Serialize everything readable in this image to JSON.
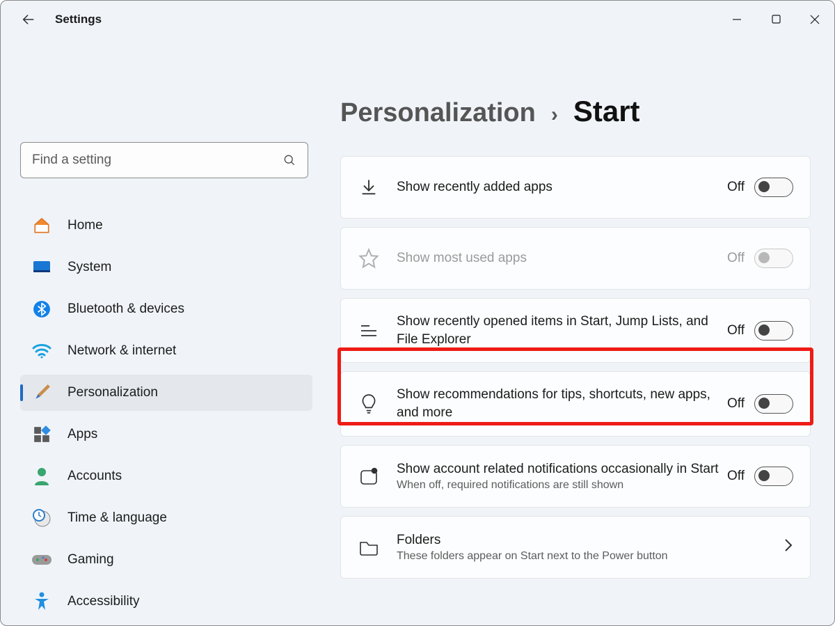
{
  "app_title": "Settings",
  "search_placeholder": "Find a setting",
  "nav": [
    {
      "id": "home",
      "label": "Home"
    },
    {
      "id": "system",
      "label": "System"
    },
    {
      "id": "bluetooth",
      "label": "Bluetooth & devices"
    },
    {
      "id": "network",
      "label": "Network & internet"
    },
    {
      "id": "personalization",
      "label": "Personalization",
      "selected": true
    },
    {
      "id": "apps",
      "label": "Apps"
    },
    {
      "id": "accounts",
      "label": "Accounts"
    },
    {
      "id": "time",
      "label": "Time & language"
    },
    {
      "id": "gaming",
      "label": "Gaming"
    },
    {
      "id": "accessibility",
      "label": "Accessibility"
    }
  ],
  "breadcrumb": {
    "parent": "Personalization",
    "current": "Start"
  },
  "settings": {
    "recent_apps": {
      "title": "Show recently added apps",
      "state": "Off"
    },
    "most_used": {
      "title": "Show most used apps",
      "state": "Off",
      "disabled": true
    },
    "recent_items": {
      "title": "Show recently opened items in Start, Jump Lists, and File Explorer",
      "state": "Off"
    },
    "recommendations": {
      "title": "Show recommendations for tips, shortcuts, new apps, and more",
      "state": "Off",
      "highlighted": true
    },
    "account_notifs": {
      "title": "Show account related notifications occasionally in Start",
      "sub": "When off, required notifications are still shown",
      "state": "Off"
    },
    "folders": {
      "title": "Folders",
      "sub": "These folders appear on Start next to the Power button"
    }
  }
}
